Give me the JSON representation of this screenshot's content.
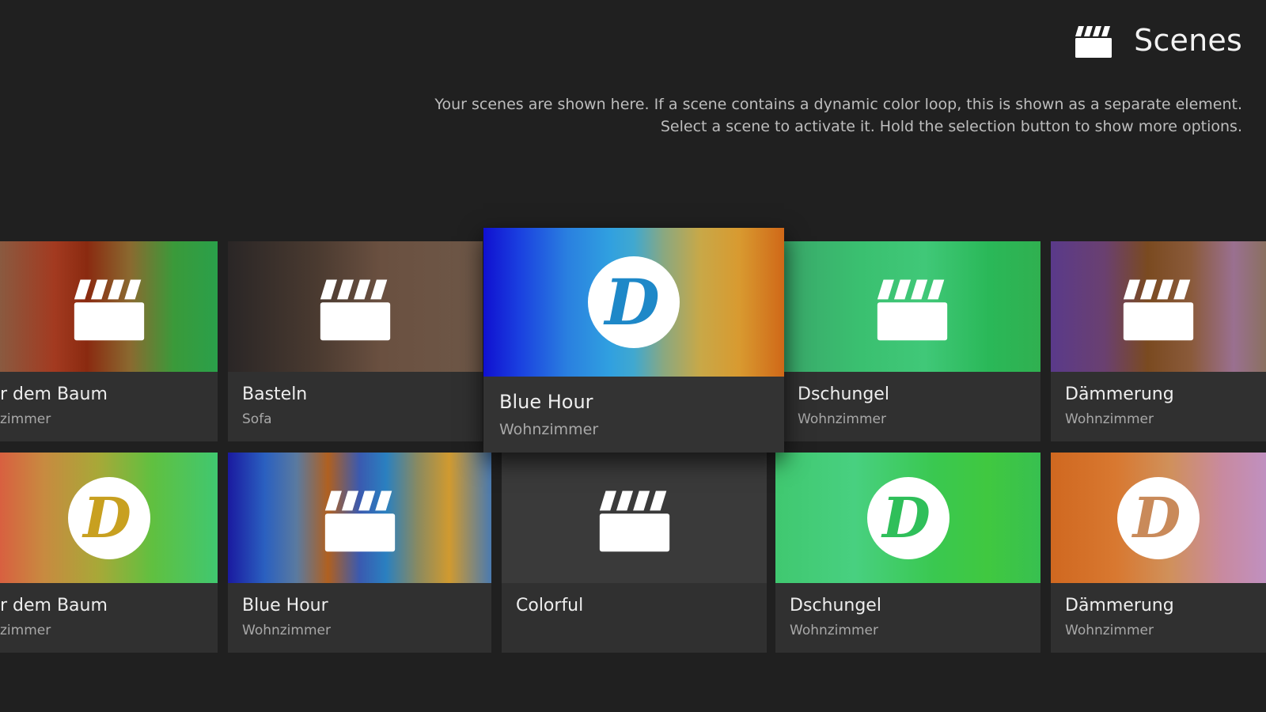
{
  "header": {
    "title": "Scenes",
    "description_line1": "Your scenes are shown here. If a scene contains a dynamic color loop, this is shown as a separate element.",
    "description_line2": "Select a scene to activate it. Hold the selection button to show more options."
  },
  "scenes_row1": [
    {
      "name": "r dem Baum",
      "room": "zimmer",
      "icon": "clapperboard-icon"
    },
    {
      "name": "Basteln",
      "room": "Sofa",
      "icon": "clapperboard-icon"
    },
    {
      "name": "Blue Hour",
      "room": "Wohnzimmer",
      "icon": "dynamic-d-icon",
      "focused": true
    },
    {
      "name": "Dschungel",
      "room": "Wohnzimmer",
      "icon": "clapperboard-icon"
    },
    {
      "name": "Dämmerung",
      "room": "Wohnzimmer",
      "icon": "clapperboard-icon"
    }
  ],
  "scenes_row2": [
    {
      "name": "r dem Baum",
      "room": "zimmer",
      "icon": "dynamic-d-icon"
    },
    {
      "name": "Blue Hour",
      "room": "Wohnzimmer",
      "icon": "clapperboard-icon"
    },
    {
      "name": "Colorful",
      "room": "",
      "icon": "clapperboard-icon"
    },
    {
      "name": "Dschungel",
      "room": "Wohnzimmer",
      "icon": "dynamic-d-icon"
    },
    {
      "name": "Dämmerung",
      "room": "Wohnzimmer",
      "icon": "dynamic-d-icon"
    }
  ],
  "colors": {
    "background": "#202020",
    "card": "#303030",
    "d_row1_blue_hour": "#1e88c8",
    "d_row2_baum": "#c8a020",
    "d_row2_dschungel": "#2fbf5a",
    "d_row2_daemmerung": "#c98a5a"
  }
}
